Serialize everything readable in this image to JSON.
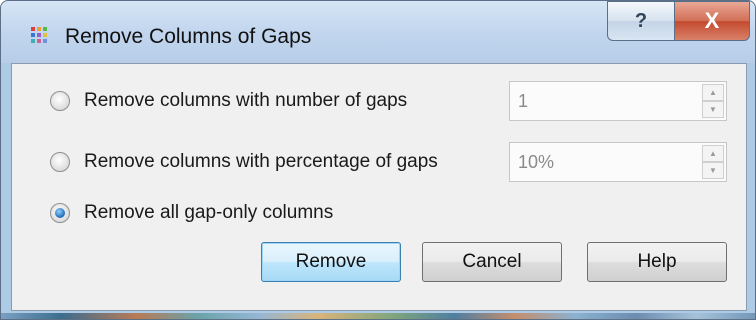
{
  "window": {
    "title": "Remove Columns of Gaps",
    "help_glyph": "?",
    "close_glyph": "X",
    "icon_colors": [
      "#e0403a",
      "#f0a030",
      "#58b848",
      "#3a78d0",
      "#9a5cc8",
      "#e0c040",
      "#40b0b0",
      "#d06090",
      "#7090e0"
    ]
  },
  "options": [
    {
      "label": "Remove columns with number of gaps",
      "selected": false,
      "spin_value": "1",
      "spin_enabled": false
    },
    {
      "label": "Remove columns with percentage of gaps",
      "selected": false,
      "spin_value": "10%",
      "spin_enabled": false
    },
    {
      "label": "Remove all gap-only columns",
      "selected": true
    }
  ],
  "buttons": {
    "remove": "Remove",
    "cancel": "Cancel",
    "help": "Help"
  }
}
